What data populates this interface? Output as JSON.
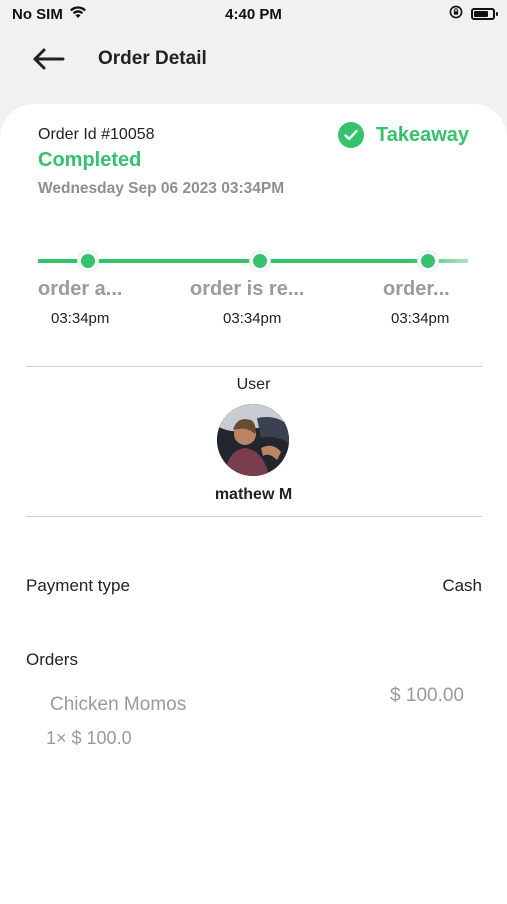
{
  "status_bar": {
    "carrier": "No SIM",
    "time": "4:40 PM"
  },
  "header": {
    "title": "Order Detail"
  },
  "order": {
    "id_text": "Order Id #10058",
    "status": "Completed",
    "type": "Takeaway",
    "date": "Wednesday Sep 06 2023 03:34PM"
  },
  "timeline": {
    "steps": [
      {
        "label": "order a...",
        "time": "03:34pm"
      },
      {
        "label": "order is re...",
        "time": "03:34pm"
      },
      {
        "label": "order...",
        "time": "03:34pm"
      }
    ]
  },
  "user": {
    "heading": "User",
    "name": "mathew M"
  },
  "payment": {
    "label": "Payment type",
    "value": "Cash"
  },
  "orders": {
    "heading": "Orders",
    "items": [
      {
        "name": "Chicken Momos",
        "qty": "1× $ 100.0",
        "price": "$ 100.00"
      }
    ]
  },
  "colors": {
    "accent": "#35c26d",
    "background": "#f1f1f1",
    "muted_text": "#9a9a9a"
  },
  "icons": {
    "back": "arrow-left-icon",
    "check": "check-circle-icon",
    "wifi": "wifi-icon",
    "lock": "orientation-lock-icon",
    "battery": "battery-icon"
  }
}
